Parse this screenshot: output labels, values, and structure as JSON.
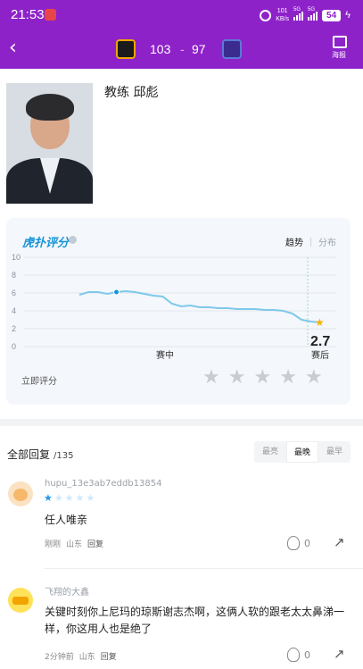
{
  "status_bar": {
    "time": "21:53",
    "net_speed": "101",
    "net_unit": "KB/s",
    "signal1": "5G",
    "signal2": "5G",
    "battery": "54"
  },
  "header": {
    "score_home": "103",
    "score_sep": "-",
    "score_away": "97",
    "poster_label": "海报"
  },
  "coach": {
    "title": "教练 邱彪"
  },
  "rating": {
    "logo": "虎扑评分",
    "tabs": [
      "趋势",
      "分布"
    ],
    "final_score": "2.7",
    "rate_label": "立即评分",
    "stars": 5
  },
  "chart_data": {
    "type": "line",
    "x_labels": [
      "赛中",
      "赛后"
    ],
    "ylim": [
      0,
      10
    ],
    "yticks": [
      0,
      2,
      4,
      6,
      8,
      10
    ],
    "values": [
      5.8,
      6.1,
      6.1,
      5.9,
      6.1,
      6.2,
      6.1,
      5.9,
      5.7,
      5.6,
      4.8,
      4.5,
      4.6,
      4.4,
      4.4,
      4.3,
      4.3,
      4.2,
      4.2,
      4.2,
      4.1,
      4.1,
      4.0,
      3.7,
      3.0,
      2.8,
      2.7
    ],
    "highlight_index": 4,
    "final": 2.7,
    "grid": true,
    "line_color": "#7fc8ea"
  },
  "replies": {
    "title": "全部回复",
    "count": "/135",
    "sort_options": [
      "最亮",
      "最晚",
      "最早"
    ],
    "sort_active": 1,
    "items": [
      {
        "user": "hupu_13e3ab7eddb13854",
        "stars": 1,
        "text": "任人唯亲",
        "time": "刚刚",
        "location": "山东",
        "reply": "回复",
        "likes": "0"
      },
      {
        "user": "飞翔的大鑫",
        "stars": 0,
        "text": "关键时刻你上尼玛的琼斯谢志杰啊，这俩人软的跟老太太鼻涕一样，你这用人也是绝了",
        "time": "2分钟前",
        "location": "山东",
        "reply": "回复",
        "likes": "0"
      }
    ]
  }
}
